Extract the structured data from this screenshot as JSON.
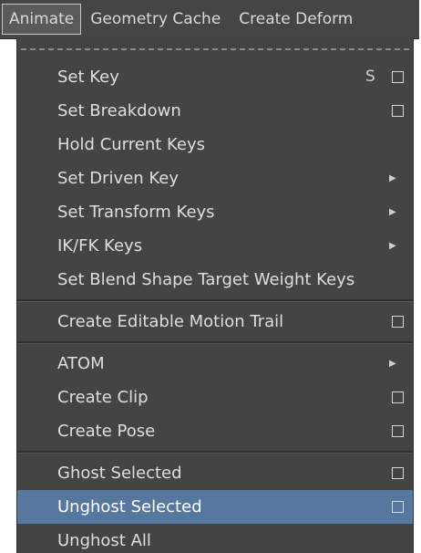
{
  "menubar": {
    "items": [
      "Animate",
      "Geometry Cache",
      "Create Deform"
    ]
  },
  "menu": {
    "group1": [
      {
        "label": "Set Key",
        "hotkey": "S"
      },
      {
        "label": "Set Breakdown"
      },
      {
        "label": "Hold Current Keys"
      },
      {
        "label": "Set Driven Key"
      },
      {
        "label": "Set Transform Keys"
      },
      {
        "label": "IK/FK Keys"
      },
      {
        "label": "Set Blend Shape Target Weight Keys"
      }
    ],
    "group2": [
      {
        "label": "Create Editable Motion Trail"
      }
    ],
    "group3": [
      {
        "label": "ATOM"
      },
      {
        "label": "Create Clip"
      },
      {
        "label": "Create Pose"
      }
    ],
    "group4": [
      {
        "label": "Ghost Selected"
      },
      {
        "label": "Unghost Selected"
      },
      {
        "label": "Unghost All"
      }
    ]
  },
  "colors": {
    "menu_bg": "#444444",
    "highlight": "#5677a0",
    "text": "#dedede"
  }
}
